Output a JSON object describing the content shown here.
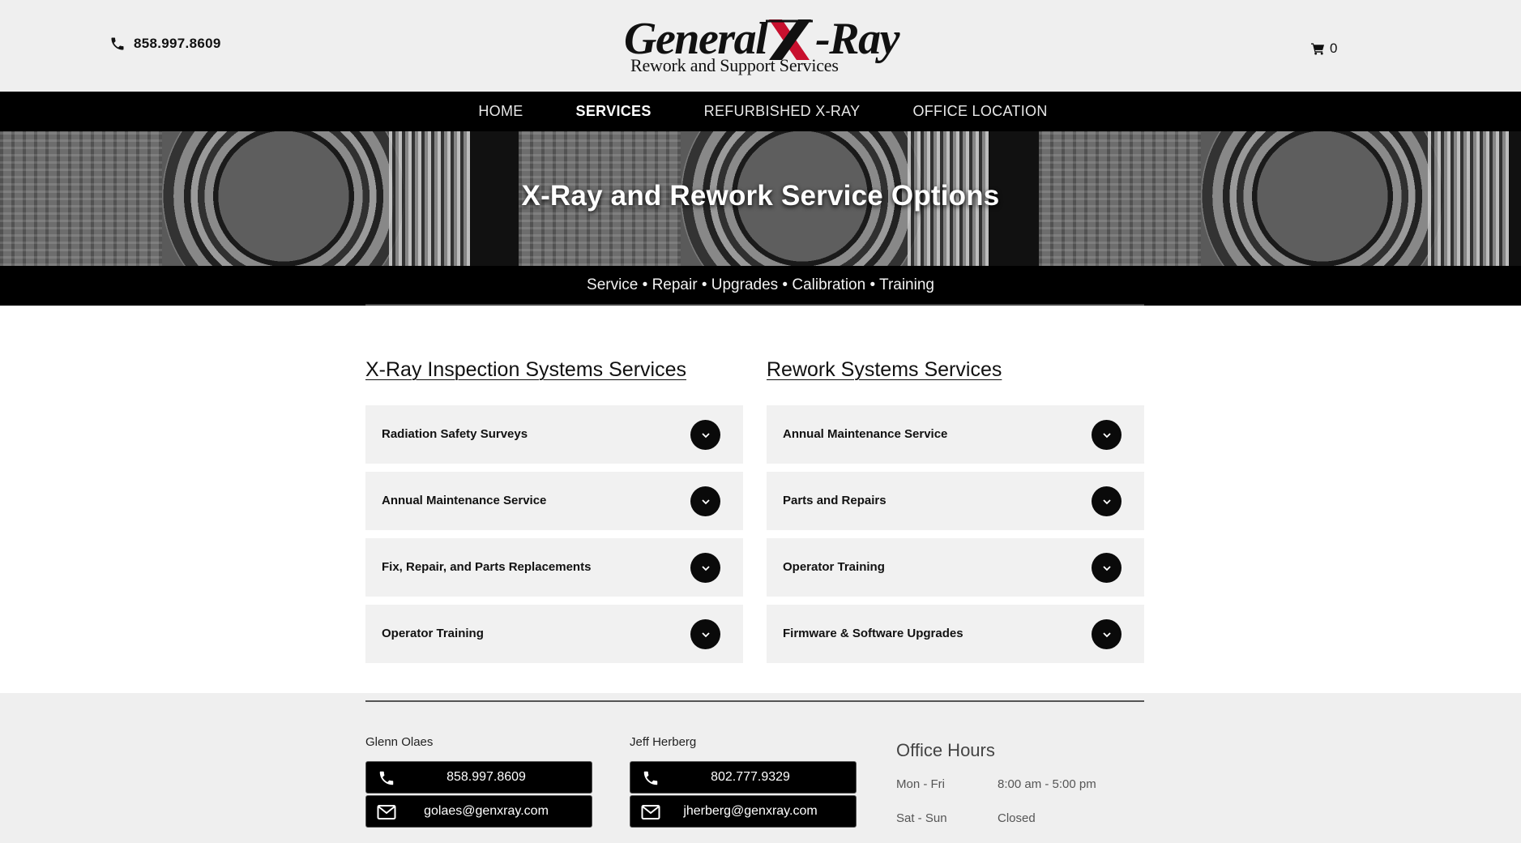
{
  "header": {
    "phone": "858.997.8609",
    "logo_main": "General X-Ray",
    "logo_sub": "Rework and Support Services",
    "cart_count": "0"
  },
  "nav": {
    "items": [
      {
        "label": "HOME"
      },
      {
        "label": "SERVICES"
      },
      {
        "label": "REFURBISHED X-RAY"
      },
      {
        "label": "OFFICE LOCATION"
      }
    ]
  },
  "hero": {
    "title": "X-Ray and Rework Service Options",
    "subtitle": "Service • Repair • Upgrades • Calibration • Training"
  },
  "services": {
    "left": {
      "title": "X-Ray Inspection Systems Services",
      "items": [
        {
          "label": "Radiation Safety Surveys"
        },
        {
          "label": "Annual Maintenance Service"
        },
        {
          "label": "Fix, Repair, and Parts Replacements"
        },
        {
          "label": "Operator Training"
        }
      ]
    },
    "right": {
      "title": "Rework Systems Services",
      "items": [
        {
          "label": "Annual Maintenance Service"
        },
        {
          "label": "Parts and Repairs"
        },
        {
          "label": "Operator Training"
        },
        {
          "label": "Firmware & Software Upgrades"
        }
      ]
    }
  },
  "footer": {
    "contacts": [
      {
        "name": "Glenn Olaes",
        "phone": "858.997.8609",
        "email": "golaes@genxray.com"
      },
      {
        "name": "Jeff Herberg",
        "phone": "802.777.9329",
        "email": "jherberg@genxray.com"
      }
    ],
    "hours": {
      "title": "Office Hours",
      "rows": [
        {
          "days": "Mon - Fri",
          "time": "8:00 am - 5:00 pm"
        },
        {
          "days": "Sat - Sun",
          "time": "Closed"
        }
      ]
    }
  },
  "colors": {
    "nav_bg": "#000000",
    "header_bg": "#efefef",
    "accordion_bg": "#f1f1f1",
    "logo_x_red": "#c8102e"
  }
}
